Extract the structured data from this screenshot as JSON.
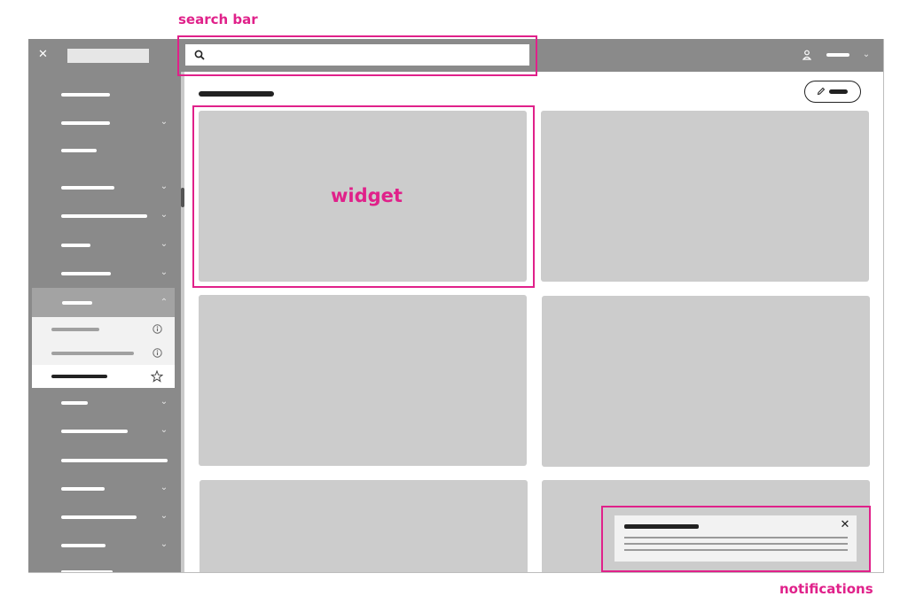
{
  "annotations": {
    "search_bar": "search bar",
    "widget": "widget",
    "notifications": "notifications"
  },
  "colors": {
    "chrome": "#8a8a8a",
    "card": "#cccccc",
    "annotation": "#e0218a",
    "submenu_bg": "#f2f2f2"
  },
  "icons": {
    "close": "close-icon",
    "search": "search-icon",
    "user": "user-icon",
    "chevron_down": "chevron-down-icon",
    "chevron_up": "chevron-up-icon",
    "info": "info-icon",
    "star": "star-icon",
    "pencil": "pencil-icon"
  },
  "search": {
    "placeholder": ""
  },
  "sidebar": {
    "items_count_note": ""
  }
}
